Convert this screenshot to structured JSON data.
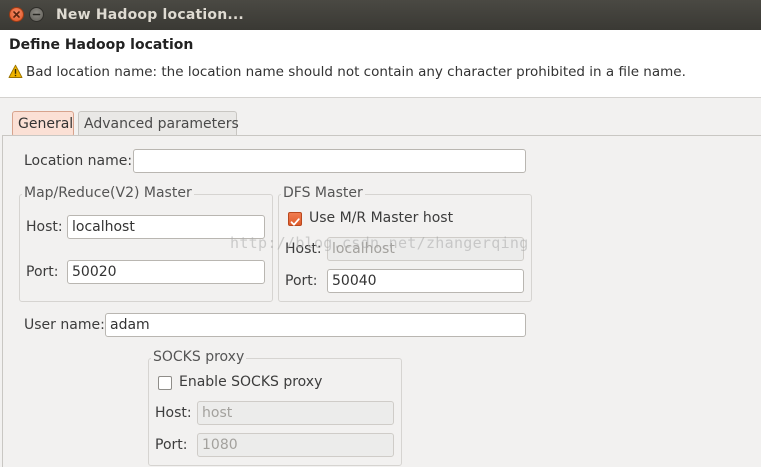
{
  "window": {
    "title": "New Hadoop location..."
  },
  "header": {
    "title": "Define Hadoop location",
    "message": "Bad location name: the location name should not contain any character prohibited in a file name."
  },
  "tabs": [
    {
      "label": "General",
      "active": true
    },
    {
      "label": "Advanced parameters",
      "active": false
    }
  ],
  "general": {
    "location_name": {
      "label": "Location name:",
      "value": ""
    },
    "mr_master": {
      "legend": "Map/Reduce(V2) Master",
      "host_label": "Host:",
      "host_value": "localhost",
      "port_label": "Port:",
      "port_value": "50020"
    },
    "dfs_master": {
      "legend": "DFS Master",
      "use_mr_label": "Use M/R Master host",
      "use_mr_checked": true,
      "host_label": "Host:",
      "host_value": "localhost",
      "port_label": "Port:",
      "port_value": "50040"
    },
    "user_name": {
      "label": "User name:",
      "value": "adam"
    },
    "socks_proxy": {
      "legend": "SOCKS proxy",
      "enable_label": "Enable SOCKS proxy",
      "enable_checked": false,
      "host_label": "Host:",
      "host_value": "host",
      "port_label": "Port:",
      "port_value": "1080"
    }
  },
  "watermark": "http://blog.csdn.net/zhangerqing",
  "colors": {
    "accent": "#e0531f",
    "titlebar": "#3f3e39",
    "warning": "#f0b400"
  }
}
